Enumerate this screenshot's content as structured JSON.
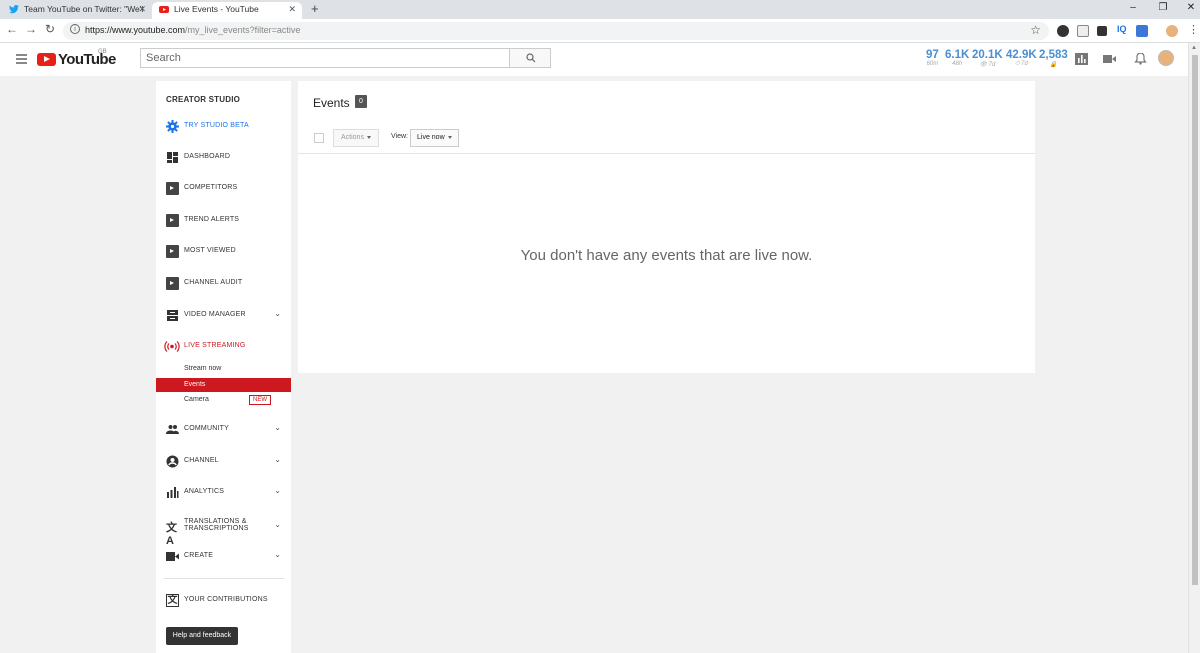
{
  "browser": {
    "tabs": [
      {
        "title": "Team YouTube on Twitter: \"We'l",
        "active": false,
        "icon": "twitter-icon"
      },
      {
        "title": "Live Events - YouTube",
        "active": true,
        "icon": "youtube-icon"
      }
    ],
    "new_tab": "+",
    "url_host": "https://www.youtube.com",
    "url_path": "/my_live_events?filter=active",
    "window_controls": [
      "–",
      "❐",
      "✕"
    ]
  },
  "header": {
    "logo_text": "YouTube",
    "logo_country": "GB",
    "search_placeholder": "Search",
    "stats": [
      {
        "value": "97",
        "sub": "60m"
      },
      {
        "value": "6.1K",
        "sub": "48h"
      },
      {
        "value": "20.1K",
        "sub": "👁 7d"
      },
      {
        "value": "42.9K",
        "sub": "⏱ 7d"
      },
      {
        "value": "2,583",
        "sub": "🔒"
      }
    ]
  },
  "sidebar": {
    "title": "CREATOR STUDIO",
    "items": [
      {
        "label": "TRY STUDIO BETA",
        "icon": "gear-icon",
        "color": "#1a73e8"
      },
      {
        "label": "DASHBOARD",
        "icon": "dashboard-icon"
      },
      {
        "label": "COMPETITORS",
        "icon": "vidiq-icon"
      },
      {
        "label": "TREND ALERTS",
        "icon": "vidiq-icon"
      },
      {
        "label": "MOST VIEWED",
        "icon": "vidiq-icon"
      },
      {
        "label": "CHANNEL AUDIT",
        "icon": "vidiq-icon"
      },
      {
        "label": "VIDEO MANAGER",
        "icon": "video-manager-icon"
      },
      {
        "label": "LIVE STREAMING",
        "icon": "live-icon",
        "color": "#cc181e"
      },
      {
        "label": "COMMUNITY",
        "icon": "community-icon"
      },
      {
        "label": "CHANNEL",
        "icon": "channel-icon"
      },
      {
        "label": "ANALYTICS",
        "icon": "analytics-icon"
      },
      {
        "label": "TRANSLATIONS & TRANSCRIPTIONS",
        "icon": "translate-icon"
      },
      {
        "label": "CREATE",
        "icon": "camera-icon"
      },
      {
        "label": "YOUR CONTRIBUTIONS",
        "icon": "translate-icon"
      }
    ],
    "sub_items": [
      {
        "label": "Stream now"
      },
      {
        "label": "Events",
        "active": true
      },
      {
        "label": "Camera",
        "badge": "NEW"
      }
    ],
    "help_button": "Help and feedback"
  },
  "main": {
    "title": "Events",
    "count": "0",
    "actions_label": "Actions",
    "view_label": "View:",
    "view_value": "Live now",
    "empty_message": "You don't have any events that are live now."
  },
  "colors": {
    "accent_red": "#cc181e",
    "stat_blue": "#4a8fd0",
    "link_blue": "#1a73e8"
  }
}
